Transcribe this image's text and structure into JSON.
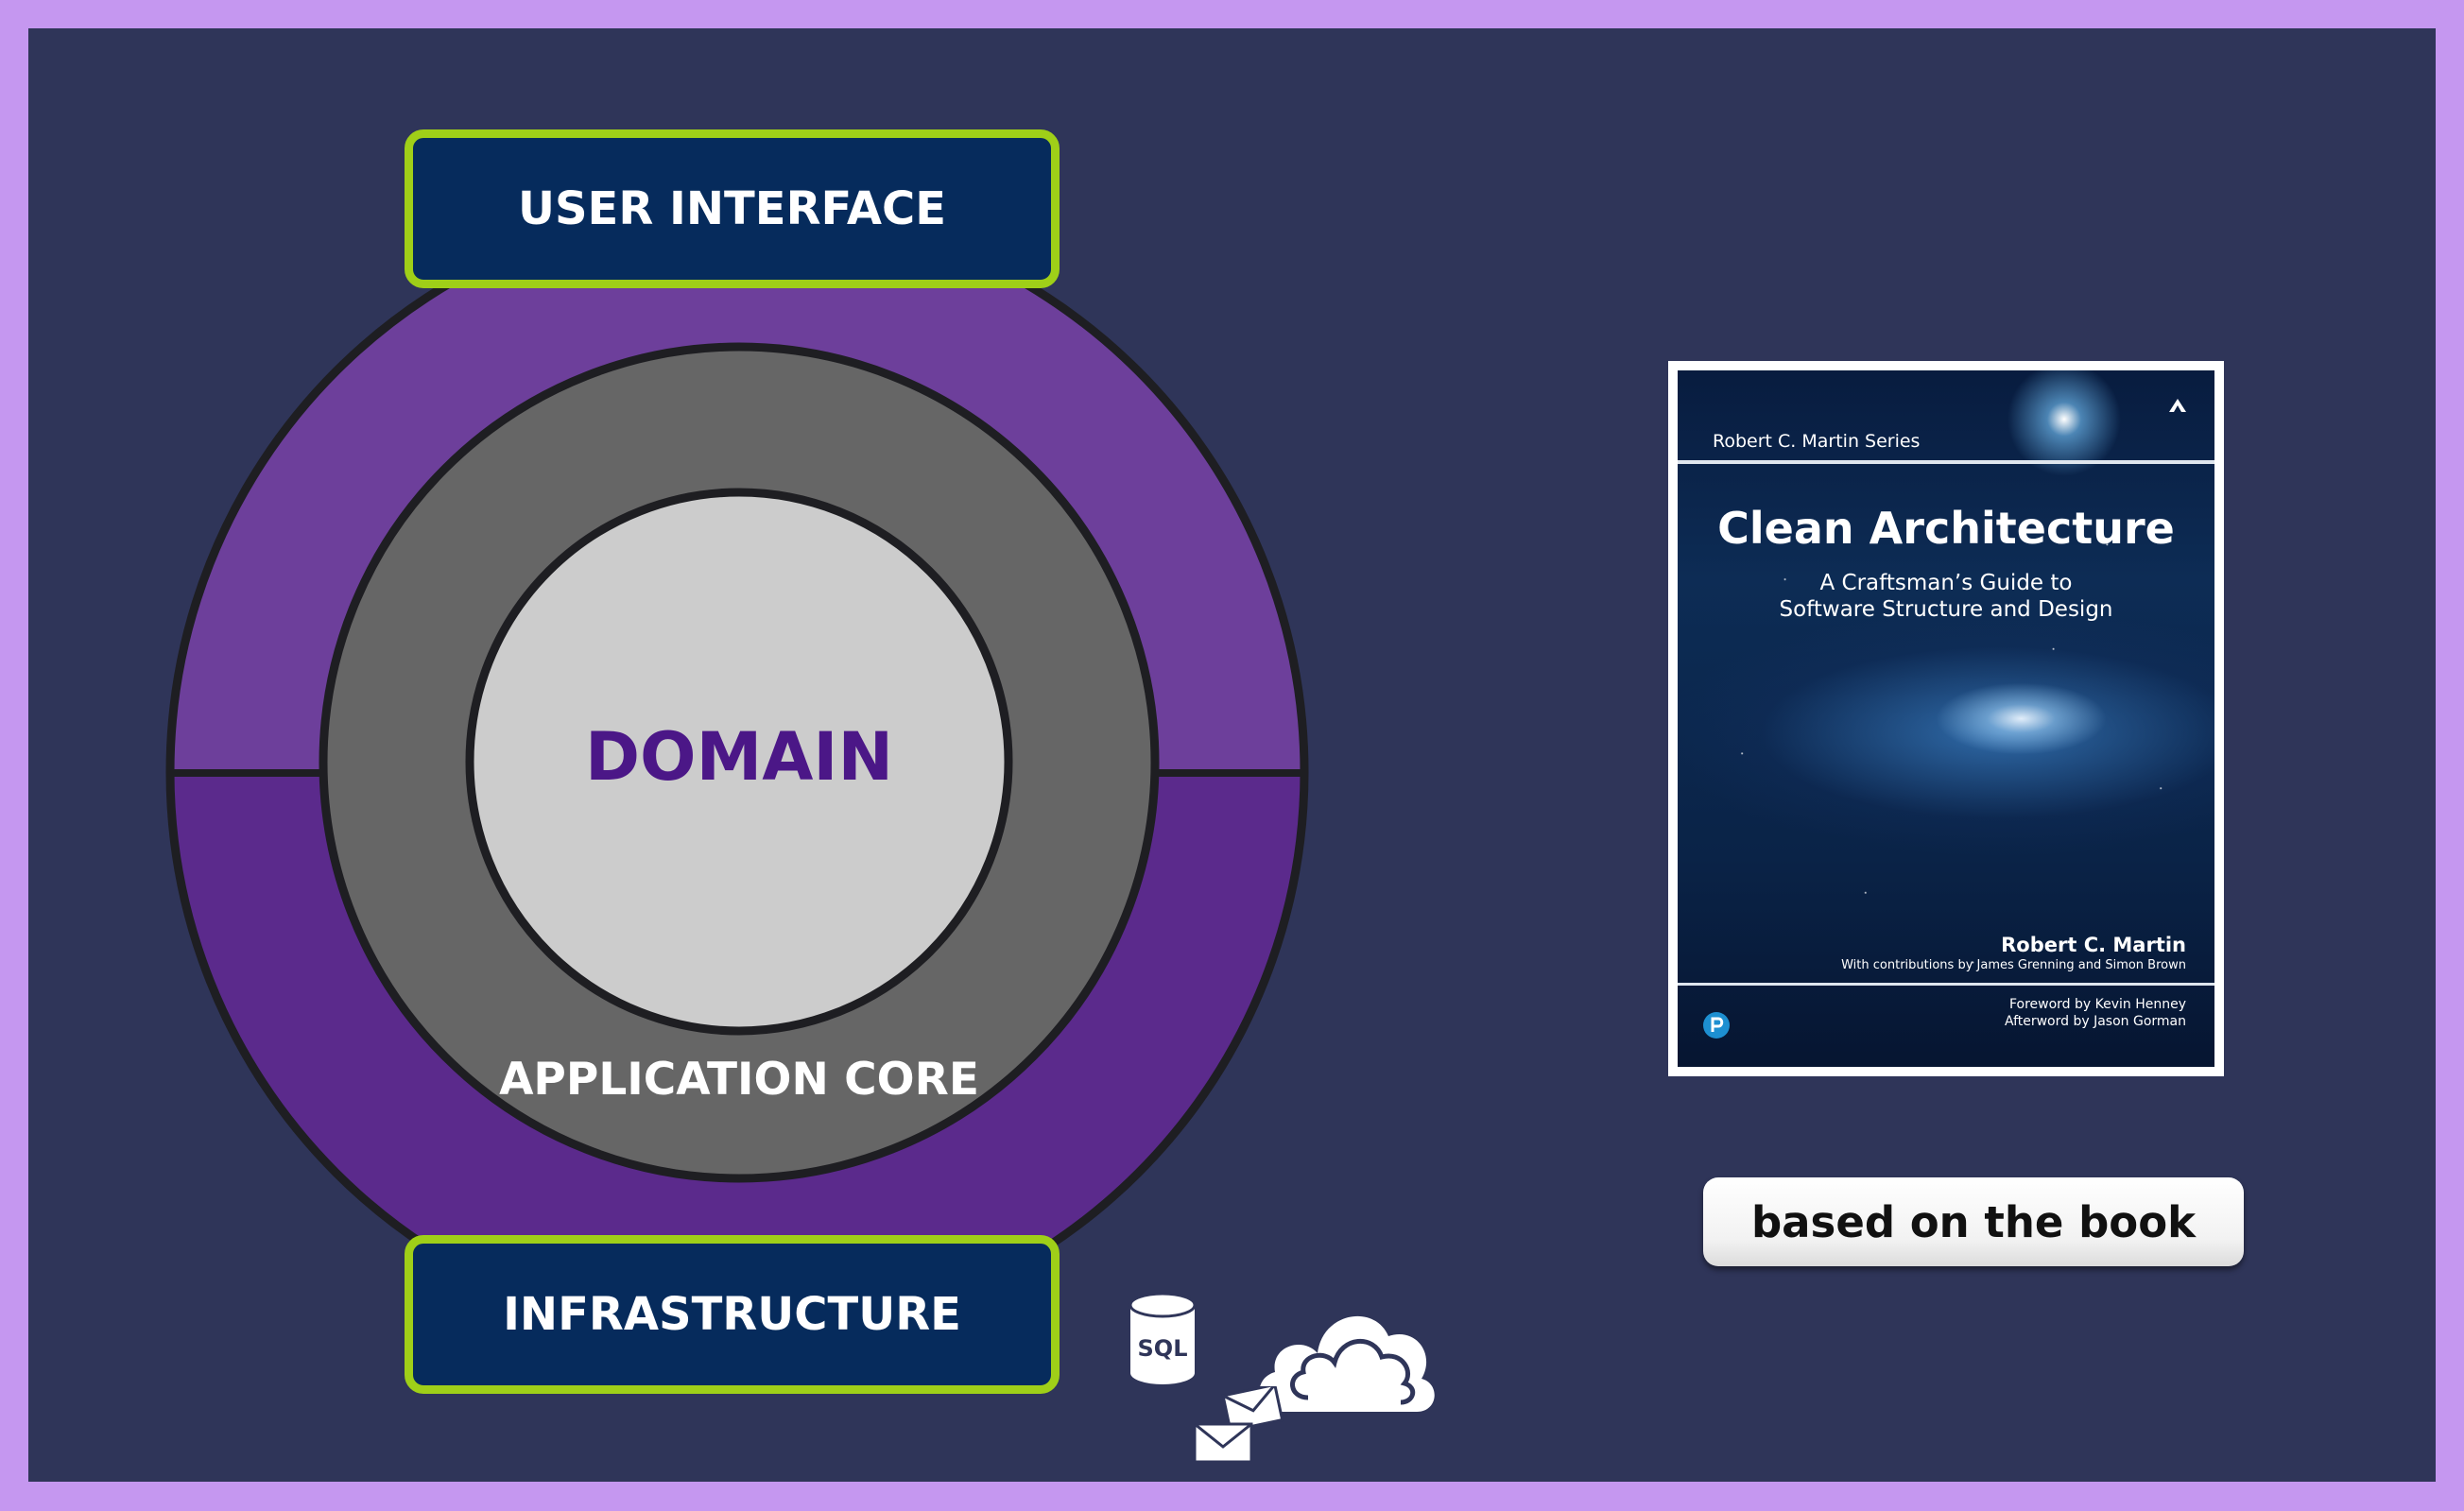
{
  "diagram": {
    "top_layer": "USER INTERFACE",
    "bottom_layer": "INFRASTRUCTURE",
    "middle_ring": "APPLICATION CORE",
    "center": "DOMAIN"
  },
  "icons": {
    "database_label": "SQL",
    "items": [
      "database-icon",
      "cloud-icon",
      "envelope-icon"
    ]
  },
  "book": {
    "series": "Robert C. Martin Series",
    "title": "Clean Architecture",
    "subtitle_line1": "A Craftsman’s Guide to",
    "subtitle_line2": "Software Structure and Design",
    "author": "Robert C. Martin",
    "contributions": "With contributions by James Grenning and Simon Brown",
    "foreword": "Foreword by Kevin Henney",
    "afterword": "Afterword by Jason Gorman"
  },
  "caption": "based on the book",
  "colors": {
    "background_border": "#c597f0",
    "canvas": "#2f3559",
    "outer_ring_top": "#6d3f9b",
    "outer_ring_bottom": "#5b2a8c",
    "middle_ring": "#666666",
    "inner_circle": "#cccccc",
    "layer_box_fill": "#062b5c",
    "layer_box_border": "#9fcf18",
    "domain_text": "#4b1787"
  }
}
